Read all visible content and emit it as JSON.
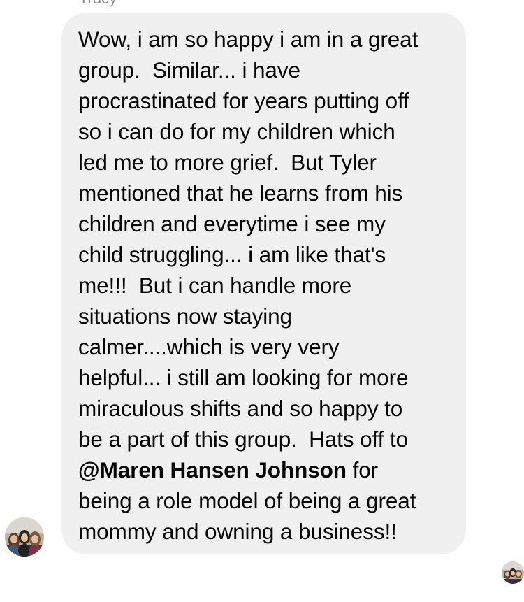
{
  "message": {
    "sender_name": "Tracy",
    "lines": [
      "Wow, i am so happy i am in a great",
      "group.  Similar... i have",
      "procrastinated for years putting off",
      "so i can do for my children which",
      "led me to more grief.  But Tyler",
      "mentioned that he learns from his",
      "children and everytime i see my",
      "child struggling... i am like that's",
      "me!!!  But i can handle more",
      "situations now staying",
      "calmer....which is very very",
      "helpful... i still am looking for more",
      "miraculous shifts and so happy to",
      "be a part of this group.  Hats off to"
    ],
    "mention": "@Maren Hansen Johnson",
    "mention_suffix": " for",
    "lines_after": [
      "being a role model of being a great",
      "mommy and owning a business!!"
    ]
  },
  "colors": {
    "bubble_background": "#f0f0f0",
    "text": "#050505",
    "sender_name": "#8a8d91"
  },
  "icons": {
    "sender_avatar": "profile-photo-avatar",
    "read_receipt": "read-receipt-avatar"
  }
}
